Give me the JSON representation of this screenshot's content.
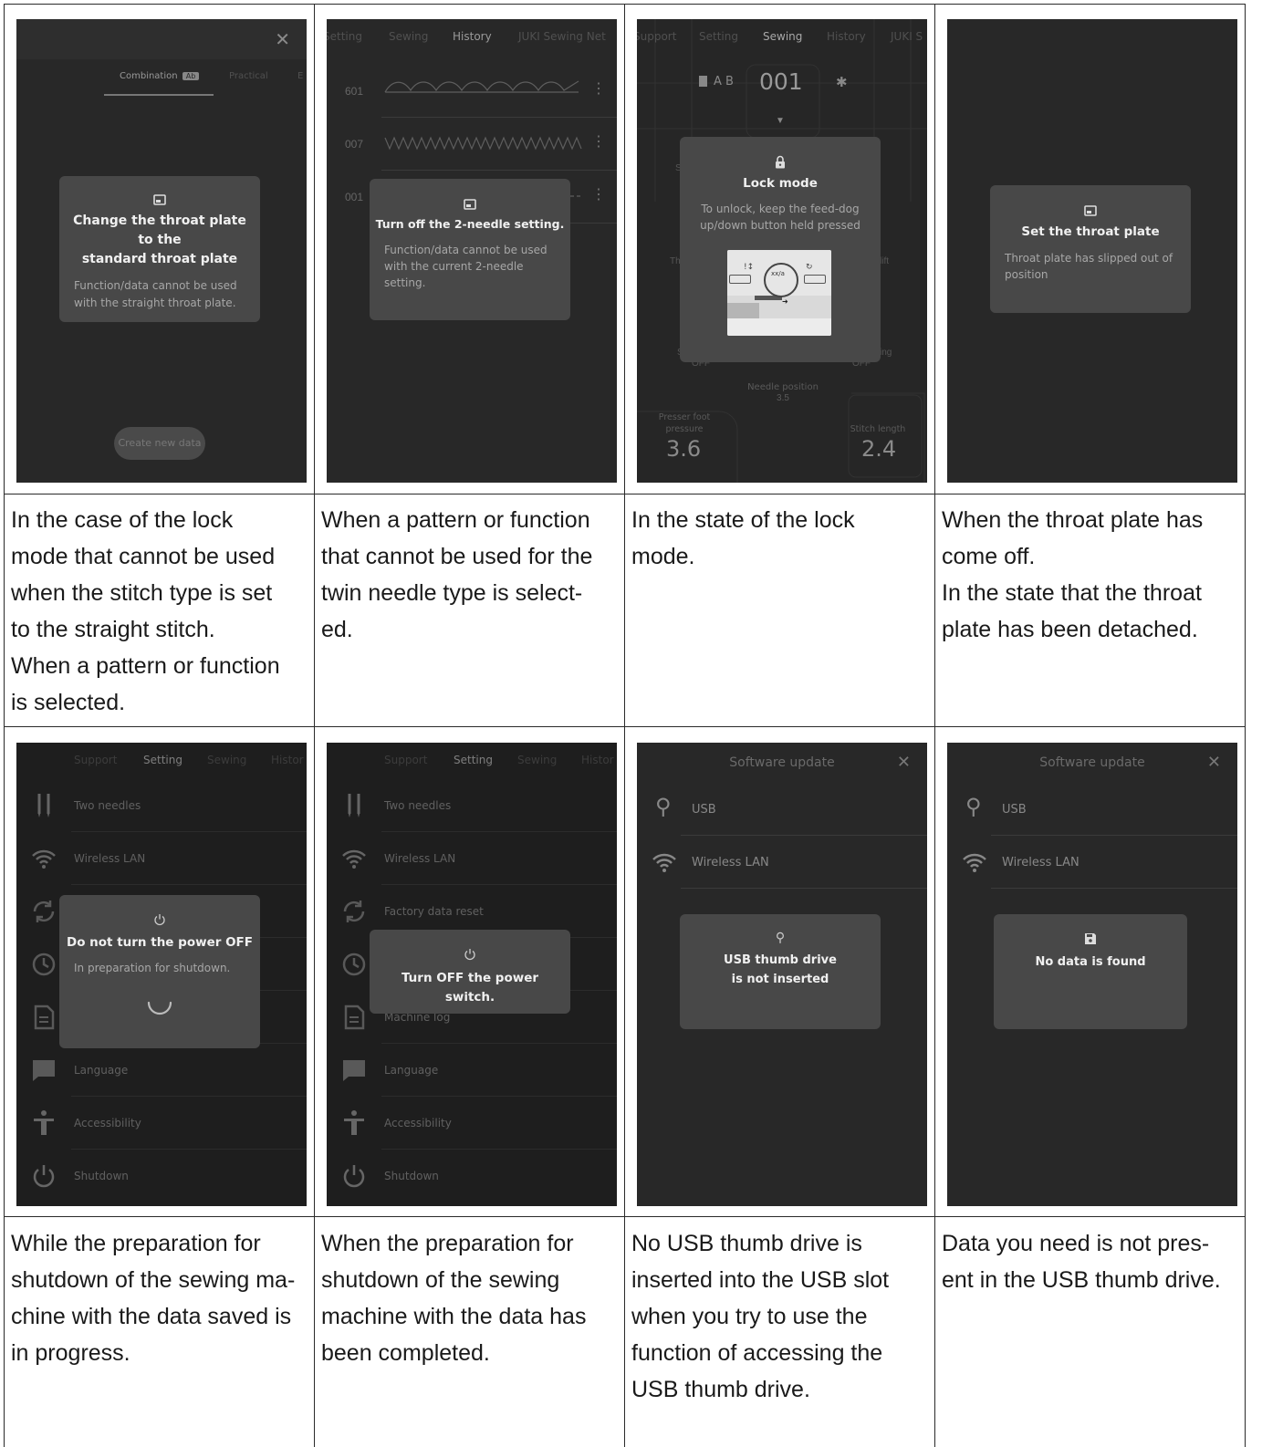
{
  "captions": [
    "In the case of the lock\nmode that cannot be used\nwhen the stitch type is set\nto the straight stitch.\nWhen a pattern or function\nis selected.",
    "When a pattern or function\nthat cannot be used for the\ntwin needle type is select-\ned.",
    "In the state of the lock\nmode.",
    "When the throat plate has\ncome off.\nIn the state that the throat\nplate has been detached.",
    "While the preparation for\nshutdown of the sewing ma-\nchine with the data saved is\nin progress.",
    "When the preparation for\nshutdown of the sewing\nmachine with the data has\nbeen completed.",
    "No USB thumb drive is\ninserted into the USB slot\nwhen you try to use the\nfunction of accessing the\nUSB thumb drive.",
    "Data you need is not pres-\nent in the USB thumb drive."
  ],
  "screen1": {
    "tabs": [
      "Combination",
      "Practical",
      "E"
    ],
    "combination_badge": "Ab",
    "modal_title": "Change the throat plate to the\nstandard throat plate",
    "modal_body": "Function/data cannot be used\nwith the straight throat plate.",
    "button": "Create new data"
  },
  "screen2": {
    "tabs": [
      "Setting",
      "Sewing",
      "History",
      "JUKI Sewing Net"
    ],
    "rows": [
      "601",
      "007",
      "001"
    ],
    "modal_title": "Turn off the 2-needle setting.",
    "modal_body": "Function/data cannot be used\nwith the current 2-needle\nsetting."
  },
  "screen3": {
    "tabs": [
      "Support",
      "Setting",
      "Sewing",
      "History",
      "JUKI S"
    ],
    "ab_label": "A B",
    "pattern_number": "001",
    "modal_title": "Lock mode",
    "modal_body": "To unlock, keep the feed-dog\nup/down button held pressed",
    "left_partial": "Th",
    "right_partial": "lift",
    "off_left": "OFF",
    "off_right": "OFF",
    "s_partial": "S",
    "ing_partial": "ing",
    "needle_position_label": "Needle position",
    "needle_position_value": "3.5",
    "presser_label": "Presser foot\npressure",
    "presser_value": "3.6",
    "stitch_length_label": "Stitch length",
    "stitch_length_value": "2.4"
  },
  "screen4": {
    "modal_title": "Set the throat plate",
    "modal_body": "Throat plate has slipped out of\nposition"
  },
  "screen5": {
    "tabs": [
      "Support",
      "Setting",
      "Sewing",
      "Histor"
    ],
    "rows": [
      "Two needles",
      "Wireless LAN",
      "",
      "",
      "",
      "Language",
      "Accessibility",
      "Shutdown"
    ],
    "modal_title": "Do not turn the power OFF",
    "modal_body": "In preparation for shutdown."
  },
  "screen6": {
    "tabs": [
      "Support",
      "Setting",
      "Sewing",
      "Histor"
    ],
    "rows": [
      "Two needles",
      "Wireless LAN",
      "Factory data reset",
      "",
      "Machine log",
      "Language",
      "Accessibility",
      "Shutdown"
    ],
    "modal_title": "Turn OFF the power switch."
  },
  "screen7": {
    "header": "Software update",
    "rows": [
      "USB",
      "Wireless LAN"
    ],
    "modal_title": "USB thumb drive\nis not inserted"
  },
  "screen8": {
    "header": "Software update",
    "rows": [
      "USB",
      "Wireless LAN"
    ],
    "modal_title": "No data is found"
  },
  "colors": {
    "screen_bg": "#282828",
    "modal_bg": "#484848",
    "border": "#2a2a2a"
  }
}
